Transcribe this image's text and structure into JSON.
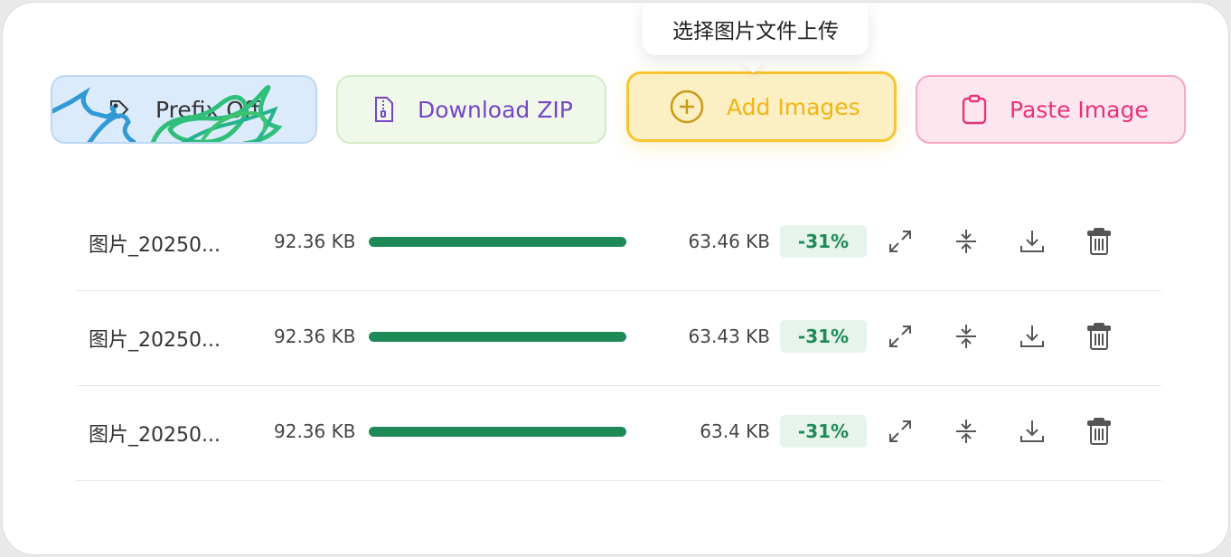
{
  "tooltip": {
    "text": "选择图片文件上传"
  },
  "toolbar": {
    "prefix_label": "Prefix Off",
    "download_zip_label": "Download ZIP",
    "add_images_label": "Add Images",
    "paste_image_label": "Paste Image"
  },
  "colors": {
    "progress": "#1e8a57",
    "badge_text": "#1e8a57",
    "zip_accent": "#7446c9",
    "add_accent": "#f2b514",
    "paste_accent": "#e8327a"
  },
  "files": [
    {
      "name": "图片_20250...",
      "original_size": "92.36 KB",
      "compressed_size": "63.46 KB",
      "reduction": "-31%",
      "progress": 1.0
    },
    {
      "name": "图片_20250...",
      "original_size": "92.36 KB",
      "compressed_size": "63.43 KB",
      "reduction": "-31%",
      "progress": 1.0
    },
    {
      "name": "图片_20250...",
      "original_size": "92.36 KB",
      "compressed_size": "63.4 KB",
      "reduction": "-31%",
      "progress": 1.0
    }
  ],
  "row_actions": [
    "expand-icon",
    "compress-icon",
    "download-icon",
    "trash-icon"
  ]
}
